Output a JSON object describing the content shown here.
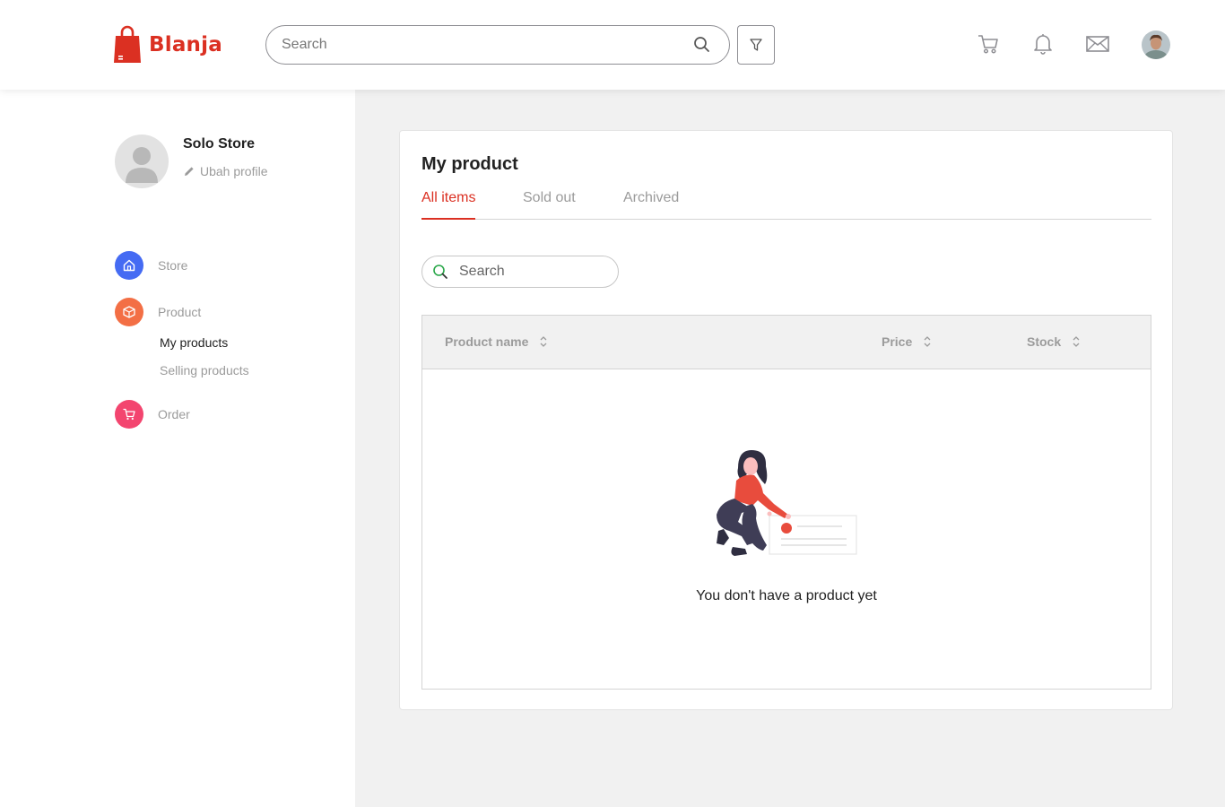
{
  "brand": {
    "name": "Blanja",
    "color": "#db3022"
  },
  "header": {
    "search_placeholder": "Search",
    "icons": [
      "search-icon",
      "filter-icon",
      "cart-icon",
      "bell-icon",
      "mail-icon",
      "user-avatar"
    ]
  },
  "sidebar": {
    "store_name": "Solo Store",
    "edit_profile": "Ubah profile",
    "nav": [
      {
        "label": "Store",
        "icon": "home-icon",
        "color": "#456bf3"
      },
      {
        "label": "Product",
        "icon": "box-icon",
        "color": "#f36f45"
      },
      {
        "label": "Order",
        "icon": "cart-icon",
        "color": "#f3456f"
      }
    ],
    "product_sub": [
      {
        "label": "My products",
        "active": true
      },
      {
        "label": "Selling products",
        "active": false
      }
    ]
  },
  "main": {
    "title": "My product",
    "tabs": [
      {
        "label": "All items",
        "active": true
      },
      {
        "label": "Sold out",
        "active": false
      },
      {
        "label": "Archived",
        "active": false
      }
    ],
    "search_placeholder": "Search",
    "table": {
      "columns": [
        "Product name",
        "Price",
        "Stock"
      ],
      "rows": [],
      "empty_text": "You don't have a product yet"
    }
  }
}
